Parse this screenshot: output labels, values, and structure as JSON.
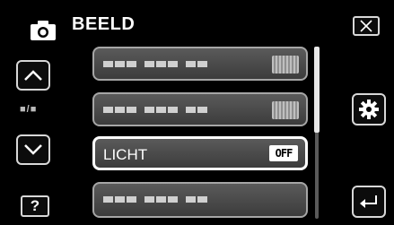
{
  "header": {
    "title": "BEELD",
    "mode_icon": "camera-icon"
  },
  "nav": {
    "up_icon": "chevron-up-icon",
    "down_icon": "chevron-down-icon",
    "page_indicator": "■/■",
    "help_label": "?"
  },
  "menu": {
    "items": [
      {
        "label": "",
        "placeholder": true
      },
      {
        "label": "",
        "placeholder": true
      },
      {
        "label": "LICHT",
        "value": "OFF",
        "highlighted": true
      },
      {
        "label": "",
        "placeholder": true
      }
    ]
  },
  "actions": {
    "close_icon": "close-icon",
    "settings_icon": "gear-icon",
    "back_icon": "return-arrow-icon"
  },
  "colors": {
    "background": "#000000",
    "item_fill": "#4a4a4a",
    "border": "#d8d8d8"
  }
}
